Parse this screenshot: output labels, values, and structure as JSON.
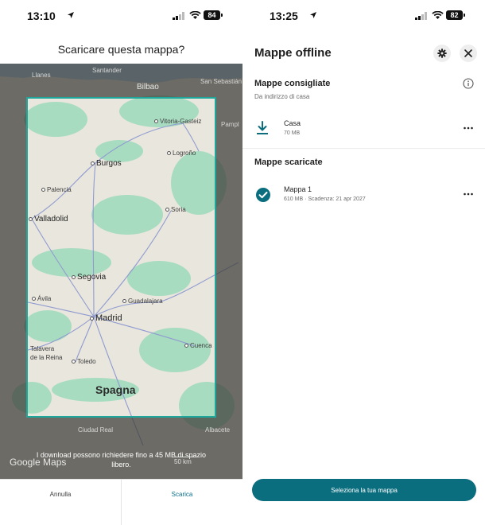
{
  "left": {
    "status": {
      "time": "13:10",
      "battery": "84"
    },
    "title": "Scaricare questa mappa?",
    "map": {
      "outside_labels": [
        {
          "text": "Llanes"
        },
        {
          "text": "Santander"
        },
        {
          "text": "Bilbao"
        },
        {
          "text": "San Sebastián"
        },
        {
          "text": "Pampl"
        },
        {
          "text": "Ciudad Real"
        },
        {
          "text": "Albacete"
        }
      ],
      "cities": [
        {
          "text": "Vitoria-Gasteiz"
        },
        {
          "text": "Logroño"
        },
        {
          "text": "Burgos"
        },
        {
          "text": "Palencia"
        },
        {
          "text": "Soria"
        },
        {
          "text": "Valladolid"
        },
        {
          "text": "Segovia"
        },
        {
          "text": "Ávila"
        },
        {
          "text": "Guadalajara"
        },
        {
          "text": "Madrid"
        },
        {
          "text": "Cuenca"
        },
        {
          "text": "Talavera"
        },
        {
          "text": "de la Reina"
        },
        {
          "text": "Toledo"
        }
      ],
      "country": "Spagna",
      "brand": "Google Maps",
      "scale": "50 km"
    },
    "disclaimer": "I download possono richiedere fino a 45 MB di spazio libero.",
    "cancel_label": "Annulla",
    "download_label": "Scarica"
  },
  "right": {
    "status": {
      "time": "13:25",
      "battery": "82"
    },
    "title": "Mappe offline",
    "recommended": {
      "heading": "Mappe consigliate",
      "subheading": "Da indirizzo di casa",
      "items": [
        {
          "name": "Casa",
          "meta": "70 MB"
        }
      ]
    },
    "downloaded": {
      "heading": "Mappe scaricate",
      "items": [
        {
          "name": "Mappa 1",
          "meta": "610 MB · Scadenza: 21 apr 2027"
        }
      ]
    },
    "select_label": "Seleziona la tua mappa"
  },
  "colors": {
    "accent": "#0b6e7f",
    "map_highlight": "#1ea79a"
  }
}
